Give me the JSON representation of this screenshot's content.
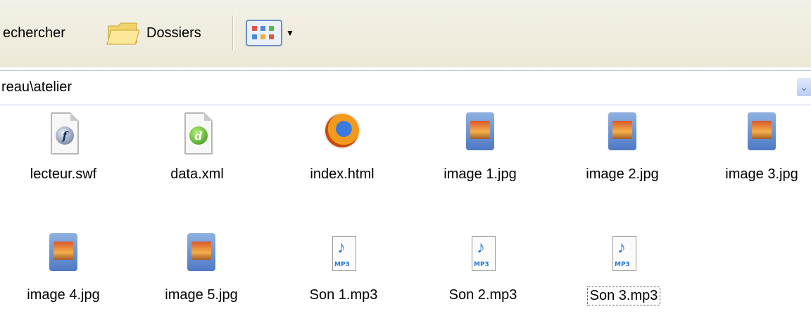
{
  "toolbar": {
    "search_label": "echercher",
    "folders_label": "Dossiers"
  },
  "address_bar": {
    "path": "reau\\atelier"
  },
  "files": [
    {
      "name": "lecteur.swf",
      "icon": "flash-file-icon"
    },
    {
      "name": "data.xml",
      "icon": "xml-file-icon"
    },
    {
      "name": "index.html",
      "icon": "firefox-html-icon"
    },
    {
      "name": "image 1.jpg",
      "icon": "jpg-image-icon"
    },
    {
      "name": "image 2.jpg",
      "icon": "jpg-image-icon"
    },
    {
      "name": "image 3.jpg",
      "icon": "jpg-image-icon"
    },
    {
      "name": "image 4.jpg",
      "icon": "jpg-image-icon"
    },
    {
      "name": "image 5.jpg",
      "icon": "jpg-image-icon"
    },
    {
      "name": "Son 1.mp3",
      "icon": "mp3-file-icon"
    },
    {
      "name": "Son 2.mp3",
      "icon": "mp3-file-icon"
    },
    {
      "name": "Son 3.mp3",
      "icon": "mp3-file-icon"
    }
  ],
  "selected_file": "Son 3.mp3"
}
